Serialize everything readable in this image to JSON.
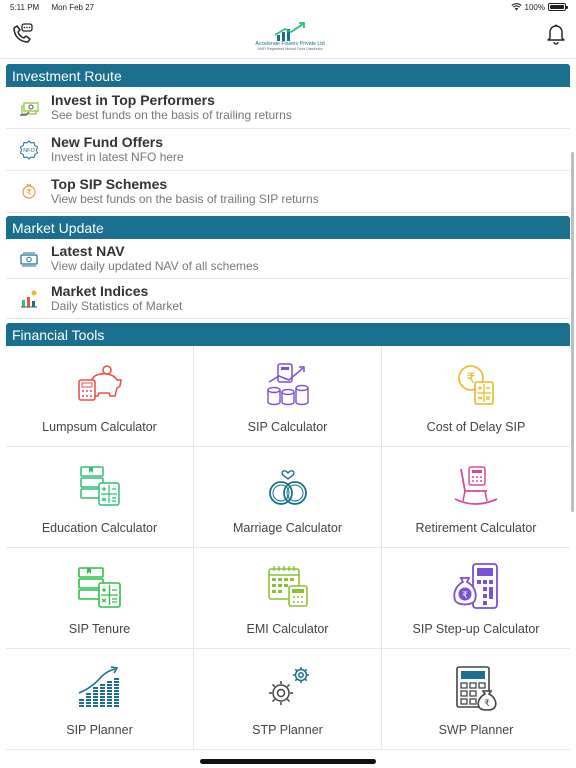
{
  "status_bar": {
    "time": "5:11 PM",
    "date": "Mon Feb 27",
    "battery": "100%"
  },
  "header": {
    "logo_text": "Accelerate Finserv Private Ltd",
    "logo_sub": "AMFI Registered Mutual Fund Distributor",
    "left_icon": "phone-chat-icon",
    "right_icon": "bell-icon"
  },
  "sections": {
    "investment_route": {
      "title": "Investment Route",
      "items": [
        {
          "title": "Invest in Top Performers",
          "sub": "See best funds on the basis of trailing returns",
          "icon": "money-stack-icon"
        },
        {
          "title": "New Fund Offers",
          "sub": "Invest in latest NFO here",
          "icon": "nfo-badge-icon"
        },
        {
          "title": "Top SIP Schemes",
          "sub": "View best funds on the basis of trailing SIP returns",
          "icon": "rupee-hand-icon"
        }
      ]
    },
    "market_update": {
      "title": "Market Update",
      "items": [
        {
          "title": "Latest NAV",
          "sub": "View daily updated NAV of all schemes",
          "icon": "cash-icon"
        },
        {
          "title": "Market Indices",
          "sub": "Daily Statistics of Market",
          "icon": "bar-chart-icon"
        }
      ]
    },
    "financial_tools": {
      "title": "Financial Tools",
      "items": [
        {
          "label": "Lumpsum Calculator",
          "icon": "piggy-bank-calculator-icon",
          "color": "#e8534a"
        },
        {
          "label": "SIP Calculator",
          "icon": "coins-calculator-icon",
          "color": "#7b4fd6"
        },
        {
          "label": "Cost of Delay SIP",
          "icon": "rupee-coin-calculator-icon",
          "color": "#e8b923"
        },
        {
          "label": "Education Calculator",
          "icon": "books-calculator-icon",
          "color": "#2ebf7a"
        },
        {
          "label": "Marriage Calculator",
          "icon": "rings-icon",
          "color": "#1b6f8e"
        },
        {
          "label": "Retirement Calculator",
          "icon": "rocking-chair-icon",
          "color": "#d64a9e"
        },
        {
          "label": "SIP Tenure",
          "icon": "books-calculator-icon",
          "color": "#2ebf4a"
        },
        {
          "label": "EMI Calculator",
          "icon": "calendar-calculator-icon",
          "color": "#8ac234"
        },
        {
          "label": "SIP Step-up Calculator",
          "icon": "money-bag-calculator-icon",
          "color": "#7b4fd6"
        },
        {
          "label": "SIP Planner",
          "icon": "growth-chart-icon",
          "color": "#1b6f8e"
        },
        {
          "label": "STP Planner",
          "icon": "gears-icon",
          "color": "#444444"
        },
        {
          "label": "SWP Planner",
          "icon": "calculator-bag-icon",
          "color": "#444444"
        }
      ]
    }
  },
  "colors": {
    "accent": "#1b6f8e"
  }
}
